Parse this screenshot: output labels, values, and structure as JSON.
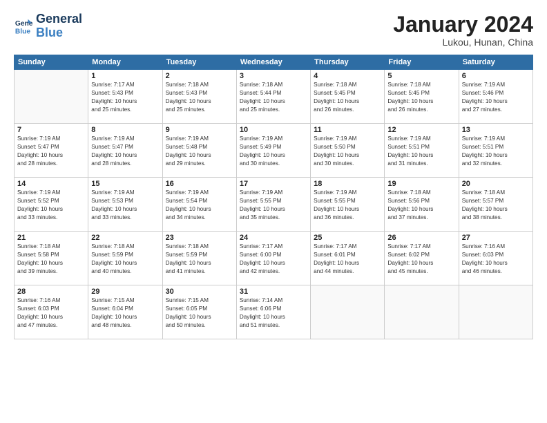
{
  "logo": {
    "line1": "General",
    "line2": "Blue"
  },
  "title": "January 2024",
  "subtitle": "Lukou, Hunan, China",
  "headers": [
    "Sunday",
    "Monday",
    "Tuesday",
    "Wednesday",
    "Thursday",
    "Friday",
    "Saturday"
  ],
  "weeks": [
    [
      {
        "day": "",
        "info": ""
      },
      {
        "day": "1",
        "info": "Sunrise: 7:17 AM\nSunset: 5:43 PM\nDaylight: 10 hours\nand 25 minutes."
      },
      {
        "day": "2",
        "info": "Sunrise: 7:18 AM\nSunset: 5:43 PM\nDaylight: 10 hours\nand 25 minutes."
      },
      {
        "day": "3",
        "info": "Sunrise: 7:18 AM\nSunset: 5:44 PM\nDaylight: 10 hours\nand 25 minutes."
      },
      {
        "day": "4",
        "info": "Sunrise: 7:18 AM\nSunset: 5:45 PM\nDaylight: 10 hours\nand 26 minutes."
      },
      {
        "day": "5",
        "info": "Sunrise: 7:18 AM\nSunset: 5:45 PM\nDaylight: 10 hours\nand 26 minutes."
      },
      {
        "day": "6",
        "info": "Sunrise: 7:19 AM\nSunset: 5:46 PM\nDaylight: 10 hours\nand 27 minutes."
      }
    ],
    [
      {
        "day": "7",
        "info": "Sunrise: 7:19 AM\nSunset: 5:47 PM\nDaylight: 10 hours\nand 28 minutes."
      },
      {
        "day": "8",
        "info": "Sunrise: 7:19 AM\nSunset: 5:47 PM\nDaylight: 10 hours\nand 28 minutes."
      },
      {
        "day": "9",
        "info": "Sunrise: 7:19 AM\nSunset: 5:48 PM\nDaylight: 10 hours\nand 29 minutes."
      },
      {
        "day": "10",
        "info": "Sunrise: 7:19 AM\nSunset: 5:49 PM\nDaylight: 10 hours\nand 30 minutes."
      },
      {
        "day": "11",
        "info": "Sunrise: 7:19 AM\nSunset: 5:50 PM\nDaylight: 10 hours\nand 30 minutes."
      },
      {
        "day": "12",
        "info": "Sunrise: 7:19 AM\nSunset: 5:51 PM\nDaylight: 10 hours\nand 31 minutes."
      },
      {
        "day": "13",
        "info": "Sunrise: 7:19 AM\nSunset: 5:51 PM\nDaylight: 10 hours\nand 32 minutes."
      }
    ],
    [
      {
        "day": "14",
        "info": "Sunrise: 7:19 AM\nSunset: 5:52 PM\nDaylight: 10 hours\nand 33 minutes."
      },
      {
        "day": "15",
        "info": "Sunrise: 7:19 AM\nSunset: 5:53 PM\nDaylight: 10 hours\nand 33 minutes."
      },
      {
        "day": "16",
        "info": "Sunrise: 7:19 AM\nSunset: 5:54 PM\nDaylight: 10 hours\nand 34 minutes."
      },
      {
        "day": "17",
        "info": "Sunrise: 7:19 AM\nSunset: 5:55 PM\nDaylight: 10 hours\nand 35 minutes."
      },
      {
        "day": "18",
        "info": "Sunrise: 7:19 AM\nSunset: 5:55 PM\nDaylight: 10 hours\nand 36 minutes."
      },
      {
        "day": "19",
        "info": "Sunrise: 7:18 AM\nSunset: 5:56 PM\nDaylight: 10 hours\nand 37 minutes."
      },
      {
        "day": "20",
        "info": "Sunrise: 7:18 AM\nSunset: 5:57 PM\nDaylight: 10 hours\nand 38 minutes."
      }
    ],
    [
      {
        "day": "21",
        "info": "Sunrise: 7:18 AM\nSunset: 5:58 PM\nDaylight: 10 hours\nand 39 minutes."
      },
      {
        "day": "22",
        "info": "Sunrise: 7:18 AM\nSunset: 5:59 PM\nDaylight: 10 hours\nand 40 minutes."
      },
      {
        "day": "23",
        "info": "Sunrise: 7:18 AM\nSunset: 5:59 PM\nDaylight: 10 hours\nand 41 minutes."
      },
      {
        "day": "24",
        "info": "Sunrise: 7:17 AM\nSunset: 6:00 PM\nDaylight: 10 hours\nand 42 minutes."
      },
      {
        "day": "25",
        "info": "Sunrise: 7:17 AM\nSunset: 6:01 PM\nDaylight: 10 hours\nand 44 minutes."
      },
      {
        "day": "26",
        "info": "Sunrise: 7:17 AM\nSunset: 6:02 PM\nDaylight: 10 hours\nand 45 minutes."
      },
      {
        "day": "27",
        "info": "Sunrise: 7:16 AM\nSunset: 6:03 PM\nDaylight: 10 hours\nand 46 minutes."
      }
    ],
    [
      {
        "day": "28",
        "info": "Sunrise: 7:16 AM\nSunset: 6:03 PM\nDaylight: 10 hours\nand 47 minutes."
      },
      {
        "day": "29",
        "info": "Sunrise: 7:15 AM\nSunset: 6:04 PM\nDaylight: 10 hours\nand 48 minutes."
      },
      {
        "day": "30",
        "info": "Sunrise: 7:15 AM\nSunset: 6:05 PM\nDaylight: 10 hours\nand 50 minutes."
      },
      {
        "day": "31",
        "info": "Sunrise: 7:14 AM\nSunset: 6:06 PM\nDaylight: 10 hours\nand 51 minutes."
      },
      {
        "day": "",
        "info": ""
      },
      {
        "day": "",
        "info": ""
      },
      {
        "day": "",
        "info": ""
      }
    ]
  ]
}
